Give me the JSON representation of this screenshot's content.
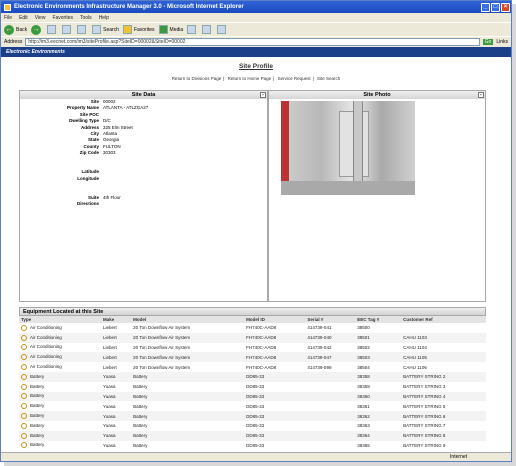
{
  "window": {
    "title": "Electronic Environments Infrastructure Manager 3.0 - Microsoft Internet Explorer",
    "menu": [
      "File",
      "Edit",
      "View",
      "Favorites",
      "Tools",
      "Help"
    ],
    "toolbar": {
      "back": "Back",
      "search": "Search",
      "favorites": "Favorites",
      "media": "Media"
    },
    "address_label": "Address",
    "address_value": "http://im3.eecnet.com/im3/siteProfile.asp?SiteID=00002&SiteID=00002",
    "go": "Go",
    "links": "Links",
    "status": "Internet"
  },
  "banner": "Electronic Environments",
  "page": {
    "heading": "Site Profile",
    "links": [
      "Return to Divisions Page",
      "Return to Home Page",
      "Service Request",
      "Site Search"
    ]
  },
  "site_data": {
    "title": "Site Data",
    "rows": [
      {
        "label": "Site",
        "value": "00002"
      },
      {
        "label": "Property Name",
        "value": "ATLANTA - ATLZGA27"
      },
      {
        "label": "Site POC",
        "value": ""
      },
      {
        "label": "Dwelling Type",
        "value": "D/C"
      },
      {
        "label": "Address",
        "value": "325 Elm Street"
      },
      {
        "label": "City",
        "value": "Atlanta"
      },
      {
        "label": "State",
        "value": "Georgia"
      },
      {
        "label": "County",
        "value": "FULTON"
      },
      {
        "label": "Zip Code",
        "value": "30303"
      },
      {
        "label": "",
        "value": ""
      },
      {
        "label": "",
        "value": ""
      },
      {
        "label": "Latitude",
        "value": ""
      },
      {
        "label": "Longitude",
        "value": ""
      },
      {
        "label": "",
        "value": ""
      },
      {
        "label": "",
        "value": ""
      },
      {
        "label": "Suite",
        "value": "4th Floor"
      },
      {
        "label": "Directions",
        "value": ""
      }
    ]
  },
  "site_photo": {
    "title": "Site Photo"
  },
  "equipment": {
    "title": "Equipment Located at this Site",
    "columns": [
      "Type",
      "Make",
      "Model",
      "Model ID",
      "Serial #",
      "EEC Tag #",
      "Customer Ref"
    ],
    "rows": [
      [
        "Air Conditioning",
        "Liebert",
        "20 Ton Downflow Air System",
        "FH740C-AAD8",
        "414739-041",
        "38500",
        ""
      ],
      [
        "Air Conditioning",
        "Liebert",
        "20 Ton Downflow Air System",
        "FH740C-AAD8",
        "414739-040",
        "38501",
        "CAHU 1103"
      ],
      [
        "Air Conditioning",
        "Liebert",
        "20 Ton Downflow Air System",
        "FH740C-AAD8",
        "414739-042",
        "38502",
        "CAHU 1104"
      ],
      [
        "Air Conditioning",
        "Liebert",
        "20 Ton Downflow Air System",
        "FH740C-AAD8",
        "414739-047",
        "38503",
        "CAHU 1105"
      ],
      [
        "Air Conditioning",
        "Liebert",
        "20 Ton Downflow Air System",
        "FH740C-AAD8",
        "414739-099",
        "38504",
        "CAHU 1106"
      ],
      [
        "Battery",
        "Yuasa",
        "Battery",
        "DD85-33",
        "",
        "38358",
        "BATTERY STRING 2"
      ],
      [
        "Battery",
        "Yuasa",
        "Battery",
        "DD85-33",
        "",
        "38359",
        "BATTERY STRING 3"
      ],
      [
        "Battery",
        "Yuasa",
        "Battery",
        "DD85-33",
        "",
        "38360",
        "BATTERY STRING 4"
      ],
      [
        "Battery",
        "Yuasa",
        "Battery",
        "DD85-33",
        "",
        "38361",
        "BATTERY STRING 5"
      ],
      [
        "Battery",
        "Yuasa",
        "Battery",
        "DD85-33",
        "",
        "38362",
        "BATTERY STRING 6"
      ],
      [
        "Battery",
        "Yuasa",
        "Battery",
        "DD85-33",
        "",
        "38363",
        "BATTERY STRING 7"
      ],
      [
        "Battery",
        "Yuasa",
        "Battery",
        "DD85-33",
        "",
        "38364",
        "BATTERY STRING 8"
      ],
      [
        "Battery",
        "Yuasa",
        "Battery",
        "DD85-33",
        "",
        "38365",
        "BATTERY STRING 9"
      ],
      [
        "Battery",
        "Yuasa",
        "Battery",
        "DD85-33",
        "",
        "38366",
        "BATTERY STRING 1"
      ]
    ]
  }
}
